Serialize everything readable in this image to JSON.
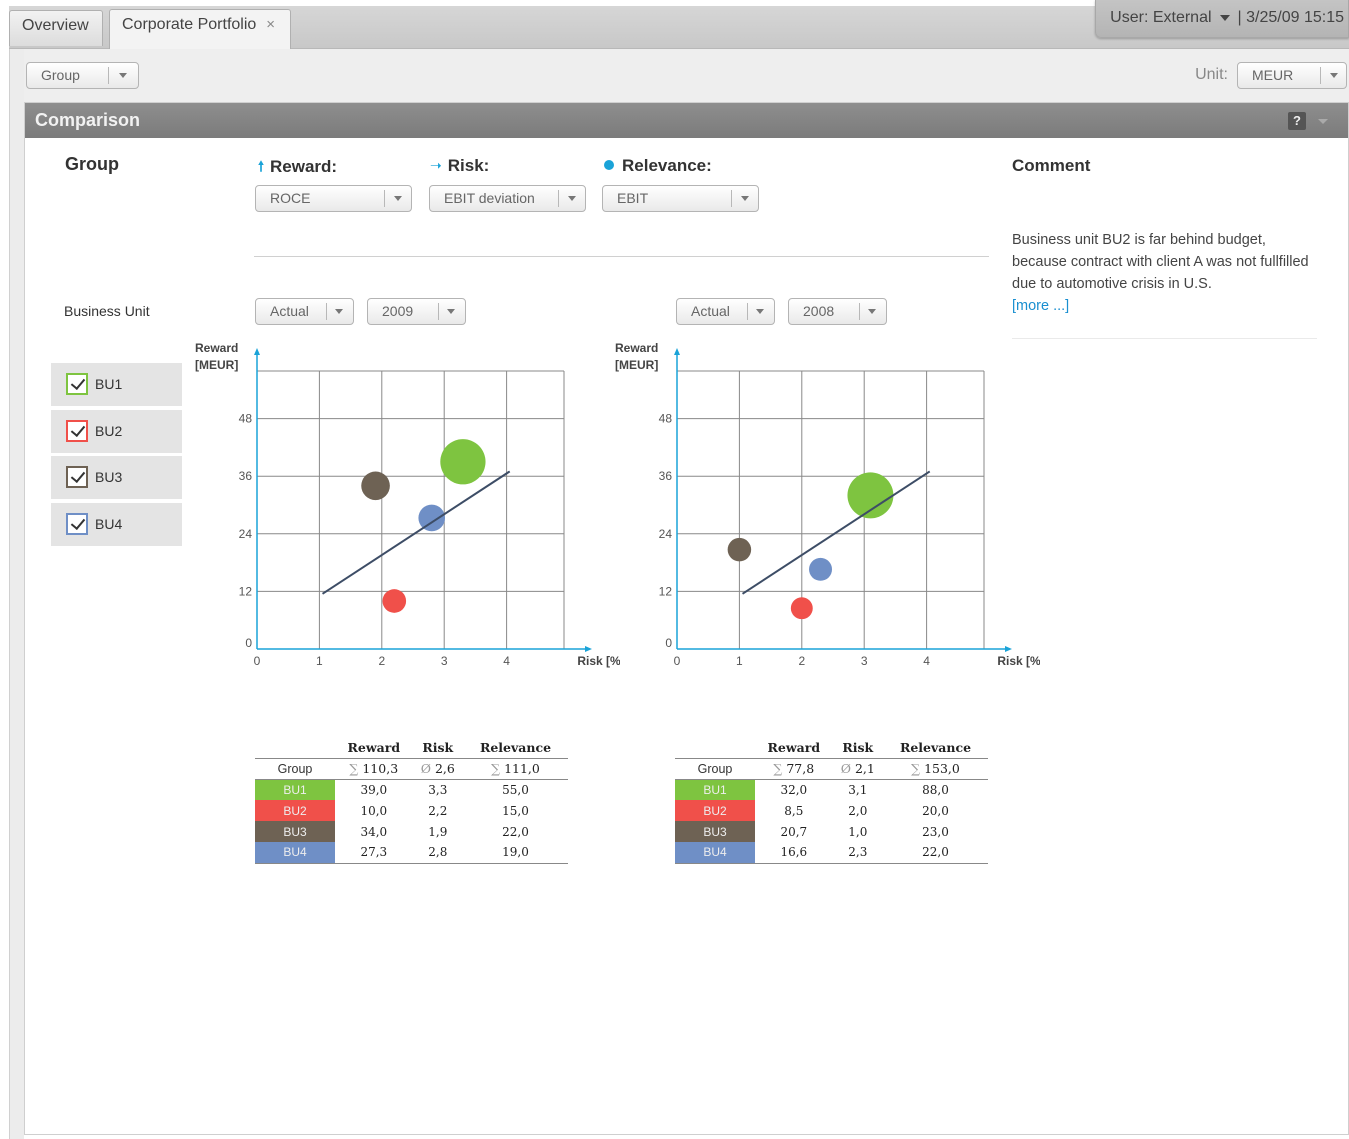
{
  "tabs": [
    {
      "label": "Overview"
    },
    {
      "label": "Corporate Portfolio",
      "close": "×"
    }
  ],
  "user": {
    "label": "User: External",
    "date": "| 3/25/09  15:15"
  },
  "toolbar": {
    "group_select": "Group",
    "unit_label": "Unit:",
    "unit_select": "MEUR"
  },
  "panel": {
    "title": "Comparison",
    "help": "?"
  },
  "labels": {
    "group": "Group",
    "reward": "Reward:",
    "risk": "Risk:",
    "relevance": "Relevance:",
    "comment": "Comment",
    "business_unit": "Business Unit"
  },
  "selects": {
    "reward": "ROCE",
    "risk": "EBIT deviation",
    "relevance": "EBIT"
  },
  "comment": {
    "text": "Business unit BU2 is far behind budget, because contract with client A was not fullfilled due to automotive crisis in U.S.",
    "more": "[more ...]"
  },
  "business_units": [
    {
      "name": "BU1",
      "color": "#7ec440",
      "checked": true
    },
    {
      "name": "BU2",
      "color": "#f0504a",
      "checked": true
    },
    {
      "name": "BU3",
      "color": "#6e6254",
      "checked": true
    },
    {
      "name": "BU4",
      "color": "#6f8fc6",
      "checked": true
    }
  ],
  "left": {
    "scenario": "Actual",
    "year": "2009"
  },
  "right": {
    "scenario": "Actual",
    "year": "2008"
  },
  "chart_data": [
    {
      "type": "scatter",
      "title": "",
      "ylabel": "Reward [MEUR]",
      "xlabel": "Risk [%]",
      "xlim": [
        0,
        5
      ],
      "ylim": [
        0,
        60
      ],
      "xticks": [
        0,
        1,
        2,
        3,
        4
      ],
      "yticks": [
        0,
        12,
        24,
        36,
        48
      ],
      "grid": true,
      "points": [
        {
          "name": "BU1",
          "x": 3.3,
          "y": 39.0,
          "size": 55.0
        },
        {
          "name": "BU2",
          "x": 2.2,
          "y": 10.0,
          "size": 15.0
        },
        {
          "name": "BU3",
          "x": 1.9,
          "y": 34.0,
          "size": 22.0
        },
        {
          "name": "BU4",
          "x": 2.8,
          "y": 27.3,
          "size": 19.0
        }
      ],
      "trendline": [
        [
          1.05,
          11.5
        ],
        [
          4.05,
          37
        ]
      ]
    },
    {
      "type": "scatter",
      "title": "",
      "ylabel": "Reward [MEUR]",
      "xlabel": "Risk [%]",
      "xlim": [
        0,
        5
      ],
      "ylim": [
        0,
        60
      ],
      "xticks": [
        0,
        1,
        2,
        3,
        4
      ],
      "yticks": [
        0,
        12,
        24,
        36,
        48
      ],
      "grid": true,
      "points": [
        {
          "name": "BU1",
          "x": 3.1,
          "y": 32.0,
          "size": 88.0
        },
        {
          "name": "BU2",
          "x": 2.0,
          "y": 8.5,
          "size": 20.0
        },
        {
          "name": "BU3",
          "x": 1.0,
          "y": 20.7,
          "size": 23.0
        },
        {
          "name": "BU4",
          "x": 2.3,
          "y": 16.6,
          "size": 22.0
        }
      ],
      "trendline": [
        [
          1.05,
          11.5
        ],
        [
          4.05,
          37
        ]
      ]
    }
  ],
  "tables": [
    {
      "headers": [
        "",
        "Reward",
        "Risk",
        "Relevance"
      ],
      "group": {
        "name": "Group",
        "reward": "110,3",
        "risk": "2,6",
        "relevance": "111,0",
        "reward_sym": "∑",
        "risk_sym": "Ø",
        "relevance_sym": "∑"
      },
      "rows": [
        {
          "name": "BU1",
          "reward": "39,0",
          "risk": "3,3",
          "relevance": "55,0"
        },
        {
          "name": "BU2",
          "reward": "10,0",
          "risk": "2,2",
          "relevance": "15,0"
        },
        {
          "name": "BU3",
          "reward": "34,0",
          "risk": "1,9",
          "relevance": "22,0"
        },
        {
          "name": "BU4",
          "reward": "27,3",
          "risk": "2,8",
          "relevance": "19,0"
        }
      ]
    },
    {
      "headers": [
        "",
        "Reward",
        "Risk",
        "Relevance"
      ],
      "group": {
        "name": "Group",
        "reward": "77,8",
        "risk": "2,1",
        "relevance": "153,0",
        "reward_sym": "∑",
        "risk_sym": "Ø",
        "relevance_sym": "∑"
      },
      "rows": [
        {
          "name": "BU1",
          "reward": "32,0",
          "risk": "3,1",
          "relevance": "88,0"
        },
        {
          "name": "BU2",
          "reward": "8,5",
          "risk": "2,0",
          "relevance": "20,0"
        },
        {
          "name": "BU3",
          "reward": "20,7",
          "risk": "1,0",
          "relevance": "23,0"
        },
        {
          "name": "BU4",
          "reward": "16,6",
          "risk": "2,3",
          "relevance": "22,0"
        }
      ]
    }
  ],
  "colors": {
    "axis": "#1aa3d8",
    "trend": "#3d4d66",
    "grid": "#888888"
  }
}
